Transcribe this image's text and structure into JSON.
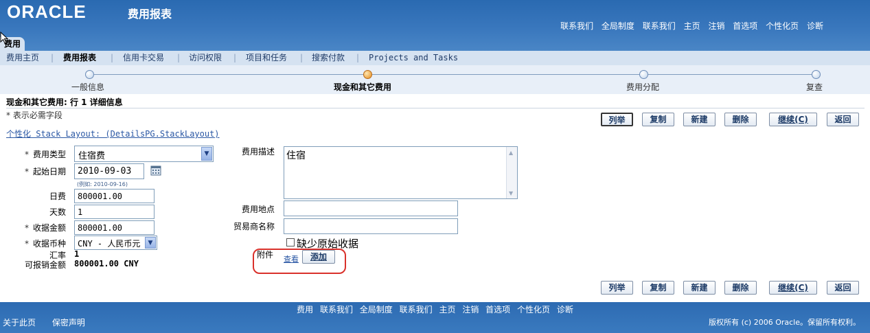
{
  "header": {
    "logo": "ORACLE",
    "app_title": "费用报表",
    "global_links": [
      "联系我们",
      "全局制度",
      "联系我们",
      "主页",
      "注销",
      "首选项",
      "个性化页",
      "诊断"
    ],
    "app_tab": "费用"
  },
  "subtabs": [
    "费用主页",
    "费用报表",
    "信用卡交易",
    "访问权限",
    "项目和任务",
    "搜索付款",
    "Projects and Tasks"
  ],
  "train": {
    "steps": [
      "一般信息",
      "现金和其它费用",
      "费用分配",
      "复查"
    ],
    "current": "现金和其它费用"
  },
  "page": {
    "title": "现金和其它费用: 行 1 详细信息",
    "required_note": "* 表示必需字段",
    "personalize_link": "个性化 Stack Layout: (DetailsPG.StackLayout)"
  },
  "buttons": {
    "list": "列举",
    "copy": "复制",
    "new": "新建",
    "delete": "删除",
    "continue": "继续(C)",
    "back": "返回"
  },
  "form": {
    "expense_type_label": "费用类型",
    "expense_type_value": "住宿费",
    "start_date_label": "起始日期",
    "start_date_value": "2010-09-03",
    "date_hint": "(例如: 2010-09-16)",
    "daily_rate_label": "日费",
    "daily_rate_value": "800001.00",
    "days_label": "天数",
    "days_value": "1",
    "receipt_amount_label": "收据金额",
    "receipt_amount_value": "800001.00",
    "receipt_currency_label": "收据币种",
    "receipt_currency_value": "CNY - 人民币元",
    "exchange_rate_label": "汇率",
    "exchange_rate_value": "1",
    "reimbursable_label": "可报销金额",
    "reimbursable_value": "800001.00 CNY",
    "description_label": "费用描述",
    "description_value": "住宿",
    "location_label": "费用地点",
    "location_value": "",
    "merchant_label": "贸易商名称",
    "merchant_value": "",
    "missing_receipt_label": "缺少原始收据",
    "missing_receipt_checked": false,
    "attachment_label": "附件",
    "attachment_view": "查看",
    "attachment_add": "添加"
  },
  "footer": {
    "links": [
      "费用",
      "联系我们",
      "全局制度",
      "联系我们",
      "主页",
      "注销",
      "首选项",
      "个性化页",
      "诊断"
    ],
    "about": "关于此页",
    "privacy": "保密声明",
    "copyright": "版权所有 (c) 2006 Oracle。保留所有权利。"
  },
  "colors": {
    "header_blue": "#3977bd",
    "tab_bar": "#d5e2f1",
    "link": "#2a57a4",
    "highlight_ring": "#d9302a"
  }
}
